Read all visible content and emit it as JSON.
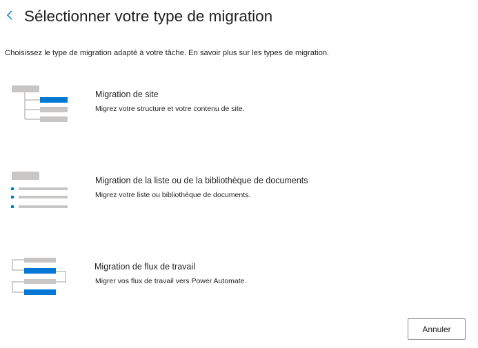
{
  "header": {
    "back_icon": "chevron-left-icon",
    "title": "Sélectionner votre type de migration"
  },
  "intro": "Choisissez le type de migration adapté à votre tâche. En savoir plus sur les types de migration.",
  "options": [
    {
      "title": "Migration de site",
      "description": "Migrez votre structure et votre contenu de site.",
      "icon": "site-hierarchy-icon"
    },
    {
      "title": "Migration de la liste ou de la bibliothèque de documents",
      "description": "Migrez votre liste ou bibliothèque de documents.",
      "icon": "list-library-icon"
    },
    {
      "title": "Migration de flux de travail",
      "description": "Migrer vos flux de travail vers Power Automate.",
      "icon": "workflow-icon"
    }
  ],
  "footer": {
    "cancel_label": "Annuler"
  },
  "colors": {
    "accent": "#0078d4",
    "placeholder_gray": "#c8c6c4",
    "connector_gray": "#a19f9d",
    "text": "#201f1e"
  }
}
